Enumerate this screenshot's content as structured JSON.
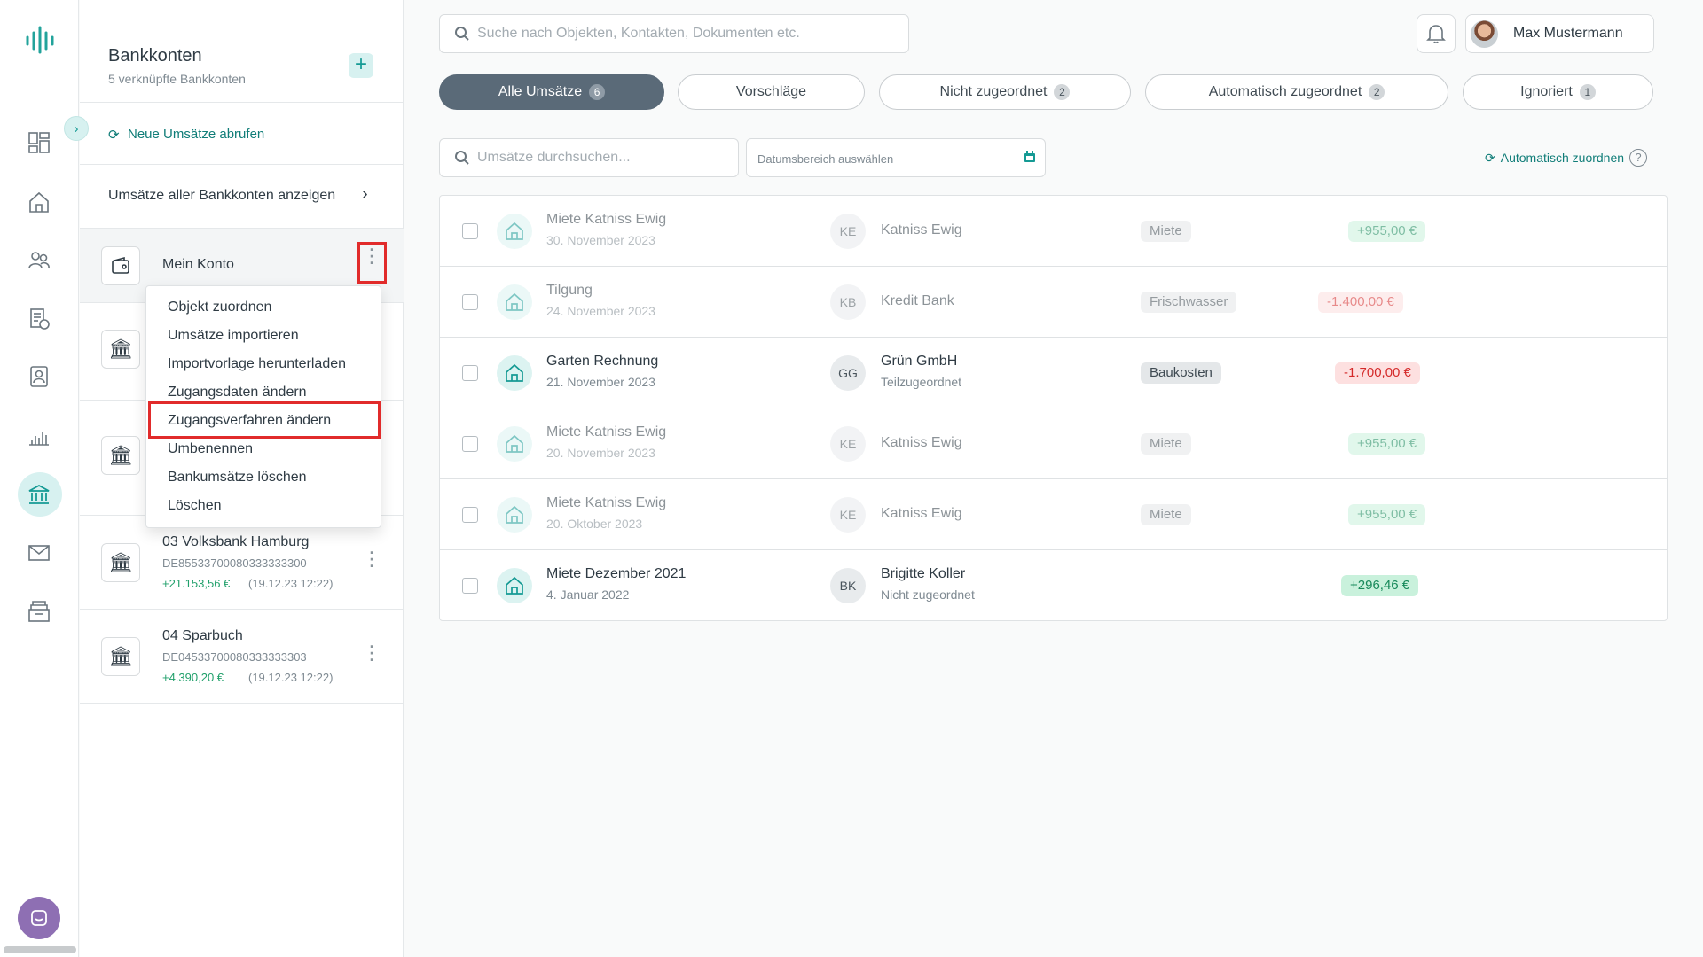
{
  "app": {
    "colors": {
      "accent": "#159a94",
      "active_tab": "#5a6a78",
      "highlight": "#e12b2b",
      "positive": "#17895a",
      "negative": "#d42a2a"
    }
  },
  "rail": {
    "items": [
      {
        "name": "dashboard-icon"
      },
      {
        "name": "home-icon"
      },
      {
        "name": "contacts-icon"
      },
      {
        "name": "documents-icon"
      },
      {
        "name": "tenant-icon"
      },
      {
        "name": "chart-icon"
      },
      {
        "name": "bank-icon",
        "active": true
      },
      {
        "name": "mail-icon"
      },
      {
        "name": "archive-icon"
      }
    ]
  },
  "sidebar": {
    "title": "Bankkonten",
    "subtitle": "5 verknüpfte Bankkonten",
    "fetch_label": "Neue Umsätze abrufen",
    "all_label": "Umsätze aller Bankkonten anzeigen",
    "accounts": [
      {
        "name": "Mein Konto"
      },
      {
        "name": "03 Volksbank Hamburg",
        "iban": "DE85533700080333333300",
        "balance": "+21.153,56 €",
        "updated": "(19.12.23 12:22)"
      },
      {
        "name": "04 Sparbuch",
        "iban": "DE04533700080333333303",
        "balance": "+4.390,20 €",
        "updated": "(19.12.23 12:22)"
      }
    ]
  },
  "context_menu": {
    "items": [
      "Objekt zuordnen",
      "Umsätze importieren",
      "Importvorlage herunterladen",
      "Zugangsdaten ändern",
      "Zugangsverfahren ändern",
      "Umbenennen",
      "Bankumsätze löschen",
      "Löschen"
    ],
    "highlighted_index": 4
  },
  "topbar": {
    "search_placeholder": "Suche nach Objekten, Kontakten, Dokumenten etc.",
    "user_name": "Max Mustermann"
  },
  "tabs": [
    {
      "label": "Alle Umsätze",
      "count": "6",
      "active": true
    },
    {
      "label": "Vorschläge",
      "count": ""
    },
    {
      "label": "Nicht zugeordnet",
      "count": "2"
    },
    {
      "label": "Automatisch zugeordnet",
      "count": "2"
    },
    {
      "label": "Ignoriert",
      "count": "1"
    }
  ],
  "filters": {
    "search_placeholder": "Umsätze durchsuchen...",
    "date_placeholder": "Datumsbereich auswählen",
    "auto_assign_label": "Automatisch zuordnen",
    "help": "?"
  },
  "transactions": [
    {
      "title": "Miete Katniss Ewig",
      "date": "30. November 2023",
      "initials": "KE",
      "contact": "Katniss Ewig",
      "contact_note": "",
      "category": "Miete",
      "amount": "+955,00 €",
      "sign": "pos",
      "faded": true
    },
    {
      "title": "Tilgung",
      "date": "24. November 2023",
      "initials": "KB",
      "contact": "Kredit Bank",
      "contact_note": "",
      "category": "Frischwasser",
      "amount": "-1.400,00 €",
      "sign": "neg",
      "faded": true
    },
    {
      "title": "Garten Rechnung",
      "date": "21. November 2023",
      "initials": "GG",
      "contact": "Grün GmbH",
      "contact_note": "Teilzugeordnet",
      "category": "Baukosten",
      "amount": "-1.700,00 €",
      "sign": "neg",
      "faded": false
    },
    {
      "title": "Miete Katniss Ewig",
      "date": "20. November 2023",
      "initials": "KE",
      "contact": "Katniss Ewig",
      "contact_note": "",
      "category": "Miete",
      "amount": "+955,00 €",
      "sign": "pos",
      "faded": true
    },
    {
      "title": "Miete Katniss Ewig",
      "date": "20. Oktober 2023",
      "initials": "KE",
      "contact": "Katniss Ewig",
      "contact_note": "",
      "category": "Miete",
      "amount": "+955,00 €",
      "sign": "pos",
      "faded": true
    },
    {
      "title": "Miete Dezember 2021",
      "date": "4. Januar 2022",
      "initials": "BK",
      "contact": "Brigitte Koller",
      "contact_note": "Nicht zugeordnet",
      "category": "",
      "amount": "+296,46 €",
      "sign": "pos",
      "faded": false
    }
  ]
}
